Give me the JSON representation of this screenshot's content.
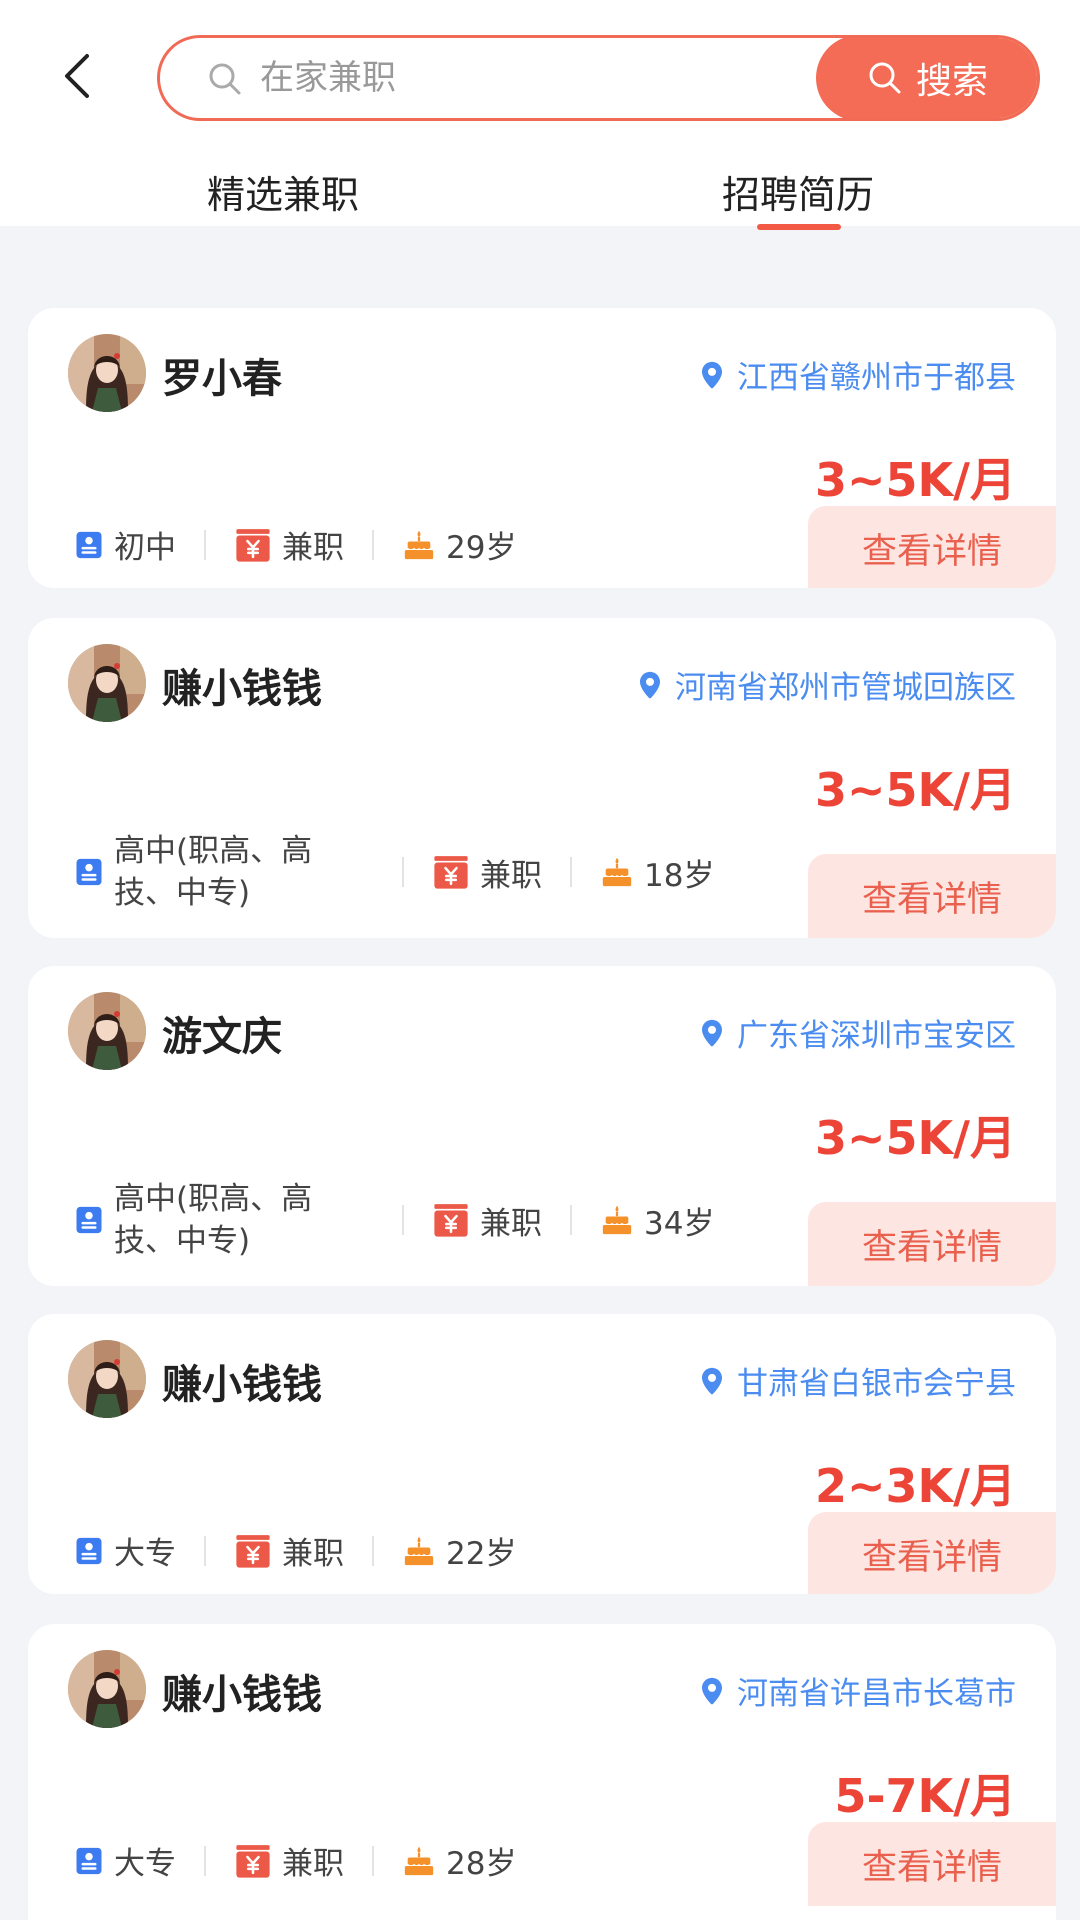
{
  "header": {
    "search_placeholder": "在家兼职",
    "search_button": "搜索"
  },
  "tabs": [
    {
      "label": "精选兼职",
      "active": false
    },
    {
      "label": "招聘简历",
      "active": true
    }
  ],
  "colors": {
    "accent": "#f46b56",
    "salary": "#ed4438",
    "location": "#4a8cf0",
    "background": "#f3f4f8"
  },
  "icons": {
    "back": "chevron-left-icon",
    "search": "search-icon",
    "location": "location-pin-icon",
    "education": "id-card-icon",
    "job_type": "yen-wallet-icon",
    "age": "birthday-cake-icon"
  },
  "cards": [
    {
      "name": "罗小春",
      "location": "江西省赣州市于都县",
      "salary": "3~5K/月",
      "education": "初中",
      "job_type": "兼职",
      "age": "29岁",
      "action": "查看详情"
    },
    {
      "name": "赚小钱钱",
      "location": "河南省郑州市管城回族区",
      "salary": "3~5K/月",
      "education": "高中(职高、高技、中专)",
      "job_type": "兼职",
      "age": "18岁",
      "action": "查看详情"
    },
    {
      "name": "游文庆",
      "location": "广东省深圳市宝安区",
      "salary": "3~5K/月",
      "education": "高中(职高、高技、中专)",
      "job_type": "兼职",
      "age": "34岁",
      "action": "查看详情"
    },
    {
      "name": "赚小钱钱",
      "location": "甘肃省白银市会宁县",
      "salary": "2~3K/月",
      "education": "大专",
      "job_type": "兼职",
      "age": "22岁",
      "action": "查看详情"
    },
    {
      "name": "赚小钱钱",
      "location": "河南省许昌市长葛市",
      "salary": "5-7K/月",
      "education": "大专",
      "job_type": "兼职",
      "age": "28岁",
      "action": "查看详情"
    }
  ]
}
